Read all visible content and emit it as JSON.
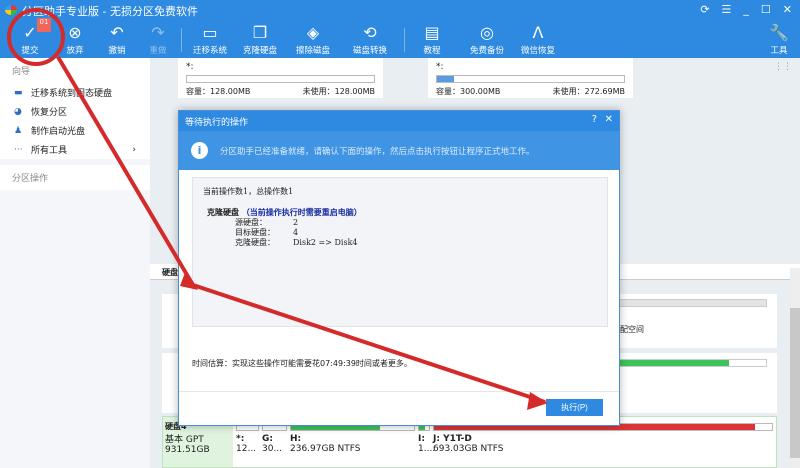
{
  "app": {
    "title": "分区助手专业版 - 无损分区免费软件"
  },
  "toolbar": {
    "badge": "01",
    "items": [
      {
        "label": "提交",
        "icon": "check-icon"
      },
      {
        "label": "放弃",
        "icon": "discard-icon"
      },
      {
        "label": "撤销",
        "icon": "undo-icon"
      },
      {
        "label": "重做",
        "icon": "redo-icon"
      },
      {
        "label": "迁移系统",
        "icon": "migrate-icon"
      },
      {
        "label": "克隆硬盘",
        "icon": "clone-icon"
      },
      {
        "label": "擦除磁盘",
        "icon": "wipe-icon"
      },
      {
        "label": "磁盘转换",
        "icon": "convert-icon"
      },
      {
        "label": "教程",
        "icon": "tutorial-icon"
      },
      {
        "label": "免费备份",
        "icon": "backup-icon"
      },
      {
        "label": "微信恢复",
        "icon": "recover-icon"
      },
      {
        "label": "工具",
        "icon": "wrench-icon"
      }
    ]
  },
  "sidebar": {
    "wizard": "向导",
    "items": [
      "迁移系统到固态硬盘",
      "恢复分区",
      "制作启动光盘",
      "所有工具"
    ],
    "partition_ops": "分区操作"
  },
  "partitions": [
    {
      "name": "*:",
      "capacity": "容量：128.00MB",
      "unused": "未使用：128.00MB",
      "used_fraction": 0
    },
    {
      "name": "*:",
      "capacity": "容量：300.00MB",
      "unused": "未使用：272.69MB",
      "used_fraction": 0.09
    }
  ],
  "disk_header": "硬盘",
  "unalloc_label": "分配空间",
  "disk4": {
    "name": "硬盘4",
    "type": "基本 GPT",
    "size": "931.51GB",
    "parts": [
      {
        "name": "*:",
        "size": "12..."
      },
      {
        "name": "G:",
        "size": "30..."
      },
      {
        "name": "H:",
        "size": "236.97GB NTFS"
      },
      {
        "name": "I:",
        "size": "1...."
      },
      {
        "name": "J: Y1T-D",
        "size": "693.03GB NTFS"
      }
    ]
  },
  "dialog": {
    "title": "等待执行的操作",
    "info": "分区助手已经准备就绪，请确认下面的操作，然后点击执行按钮让程序正式地工作。",
    "count": "当前操作数1，总操作数1",
    "op_title": "克隆硬盘",
    "op_note": "（当前操作执行时需要重启电脑）",
    "details": [
      {
        "k": "源硬盘：",
        "v": "2"
      },
      {
        "k": "目标硬盘：",
        "v": "4"
      },
      {
        "k": "克隆硬盘：",
        "v": "Disk2 => Disk4"
      }
    ],
    "estimate": "时间估算：实现这些操作可能需要花07:49:39时间或者更多。",
    "execute": "执行(P)"
  },
  "colors": {
    "accent": "#2d8ae0",
    "annotation": "#d42a2a"
  }
}
